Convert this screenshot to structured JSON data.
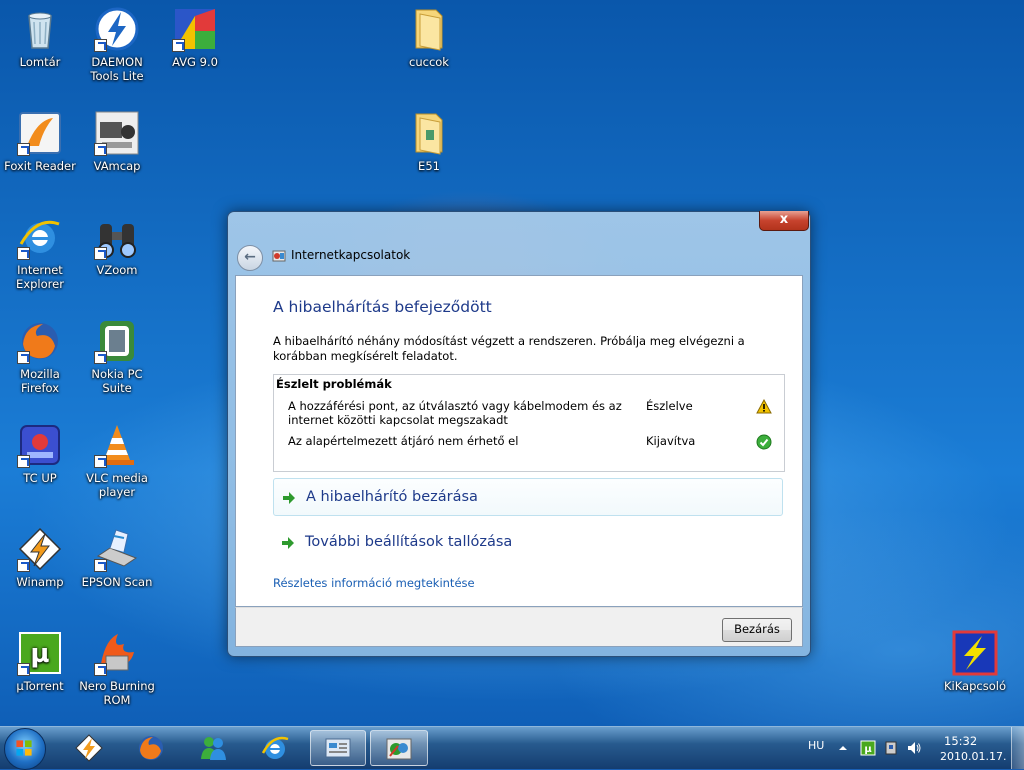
{
  "desktop_icons": [
    {
      "label": "Lomtár",
      "icon": "recycle-bin-icon"
    },
    {
      "label": "DAEMON Tools Lite",
      "icon": "daemon-tools-icon"
    },
    {
      "label": "AVG 9.0",
      "icon": "avg-icon"
    },
    {
      "label": "cuccok",
      "icon": "folder-icon"
    },
    {
      "label": "Foxit Reader",
      "icon": "foxit-reader-icon"
    },
    {
      "label": "VAmcap",
      "icon": "vamcap-icon"
    },
    {
      "label": "E51",
      "icon": "folder-icon"
    },
    {
      "label": "Internet Explorer",
      "icon": "internet-explorer-icon"
    },
    {
      "label": "VZoom",
      "icon": "binoculars-icon"
    },
    {
      "label": "Mozilla Firefox",
      "icon": "firefox-icon"
    },
    {
      "label": "Nokia PC Suite",
      "icon": "nokia-pc-suite-icon"
    },
    {
      "label": "TC UP",
      "icon": "tc-up-icon"
    },
    {
      "label": "VLC media player",
      "icon": "vlc-icon"
    },
    {
      "label": "Winamp",
      "icon": "winamp-icon"
    },
    {
      "label": "EPSON Scan",
      "icon": "scanner-icon"
    },
    {
      "label": "µTorrent",
      "icon": "utorrent-icon"
    },
    {
      "label": "Nero Burning ROM",
      "icon": "nero-icon"
    },
    {
      "label": "KiKapcsoló",
      "icon": "lightning-icon"
    }
  ],
  "dialog": {
    "close_glyph": "x",
    "nav_title": "Internetkapcsolatok",
    "heading": "A hibaelhárítás befejeződött",
    "description": "A hibaelhárító néhány módosítást végzett a rendszeren. Próbálja meg elvégezni a korábban megkísérelt feladatot.",
    "problems_title": "Észlelt problémák",
    "problems": [
      {
        "text": "A hozzáférési pont, az útválasztó vagy kábelmodem és az internet közötti kapcsolat megszakadt",
        "status": "Észlelve",
        "icon": "warning-icon"
      },
      {
        "text": "Az alapértelmezett átjáró nem érhető el",
        "status": "Kijavítva",
        "icon": "check-icon"
      }
    ],
    "command_close": "A hibaelhárító bezárása",
    "command_more": "További beállítások tallózása",
    "details_link": "Részletes információ megtekintése",
    "close_button": "Bezárás"
  },
  "taskbar": {
    "pinned": [
      "winamp-icon",
      "firefox-icon",
      "messenger-icon",
      "internet-explorer-icon",
      "control-panel-icon",
      "network-troubleshooter-icon"
    ],
    "language": "HU",
    "time": "15:32",
    "date": "2010.01.17."
  },
  "colors": {
    "heading": "#1e3a8a",
    "link": "#1a5fb4",
    "arrow": "#2e9a2e",
    "warning": "#f2c200",
    "check": "#3cae3c"
  }
}
